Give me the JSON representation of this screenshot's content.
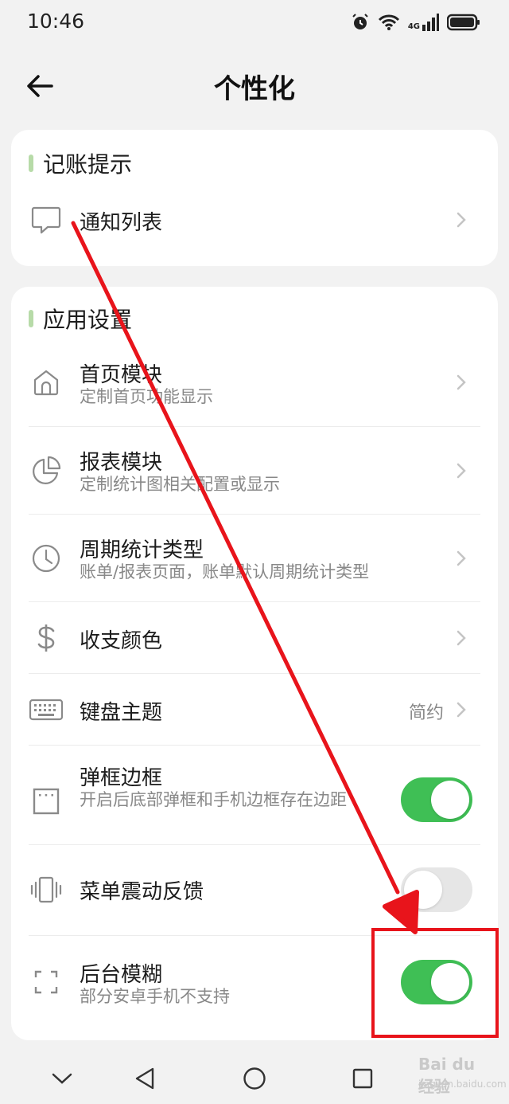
{
  "status_bar": {
    "time": "10:46",
    "network_label": "4G",
    "icons": [
      "alarm-icon",
      "wifi-icon",
      "signal-icon",
      "battery-icon"
    ]
  },
  "header": {
    "title": "个性化",
    "back_icon": "arrow-left-icon"
  },
  "sections": [
    {
      "title": "记账提示",
      "rows": [
        {
          "icon": "chat-bubble-icon",
          "title": "通知列表",
          "control": "chevron"
        }
      ]
    },
    {
      "title": "应用设置",
      "rows": [
        {
          "icon": "home-icon",
          "title": "首页模块",
          "subtitle": "定制首页功能显示",
          "control": "chevron"
        },
        {
          "icon": "pie-chart-icon",
          "title": "报表模块",
          "subtitle": "定制统计图相关配置或显示",
          "control": "chevron"
        },
        {
          "icon": "clock-icon",
          "title": "周期统计类型",
          "subtitle": "账单/报表页面，账单默认周期统计类型",
          "control": "chevron"
        },
        {
          "icon": "dollar-icon",
          "title": "收支颜色",
          "control": "chevron"
        },
        {
          "icon": "keyboard-icon",
          "title": "键盘主题",
          "value": "简约",
          "control": "chevron"
        },
        {
          "icon": "frame-icon",
          "title": "弹框边框",
          "subtitle": "开启后底部弹框和手机边框存在边距",
          "control": "toggle",
          "on": true
        },
        {
          "icon": "vibrate-icon",
          "title": "菜单震动反馈",
          "control": "toggle",
          "on": false
        },
        {
          "icon": "blur-corners-icon",
          "title": "后台模糊",
          "subtitle": "部分安卓手机不支持",
          "control": "toggle",
          "on": true
        }
      ]
    }
  ],
  "nav_bar": {
    "buttons": [
      "collapse-down-icon",
      "back-triangle-icon",
      "home-circle-icon",
      "recents-square-icon"
    ]
  },
  "watermark": {
    "brand": "Bai du 经验",
    "site": "jingyan.baidu.com"
  },
  "colors": {
    "accent_green": "#3fbf55",
    "section_bar": "#b7dba8",
    "annotation_red": "#e8141b",
    "background": "#f2f2f2"
  }
}
